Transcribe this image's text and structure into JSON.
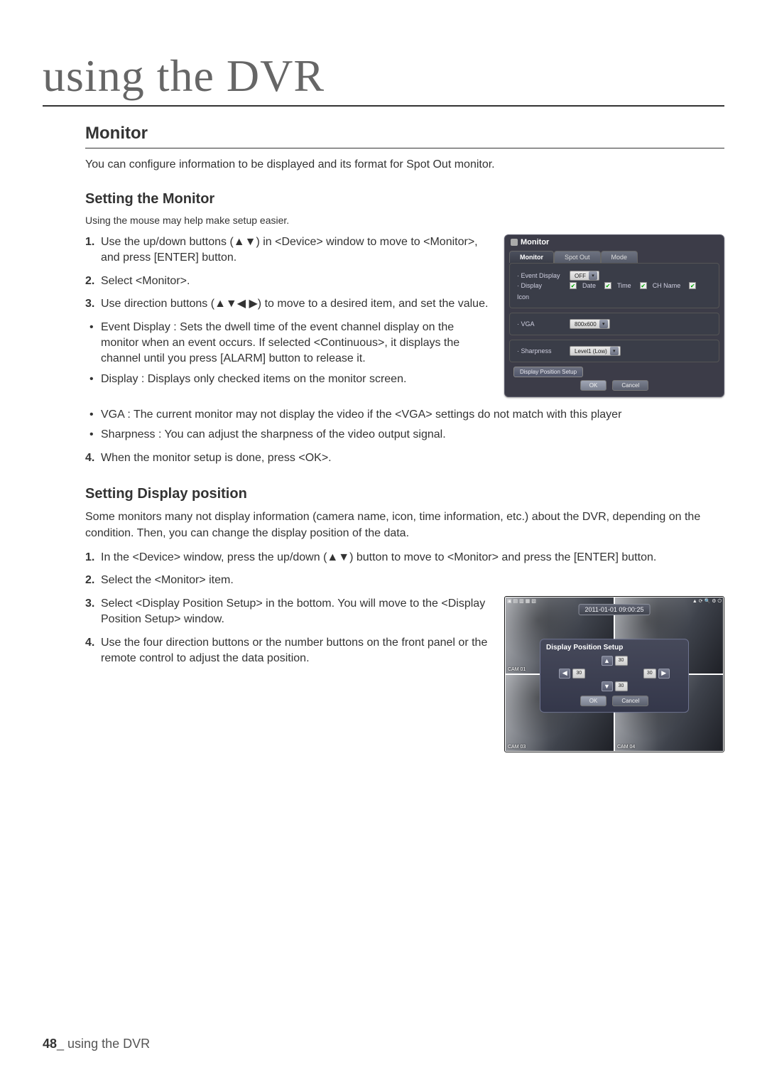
{
  "header": "using the DVR",
  "section": {
    "title": "Monitor",
    "intro": "You can configure information to be displayed and its format for Spot Out monitor."
  },
  "settingMonitor": {
    "heading": "Setting the Monitor",
    "note": "Using the mouse may help make setup easier.",
    "steps": [
      "Use the up/down buttons (▲▼) in <Device> window to move to <Monitor>, and press [ENTER] button.",
      "Select <Monitor>.",
      "Use direction buttons (▲▼◀ ▶) to move to a desired item, and set the value."
    ],
    "bullets_top": [
      "Event Display : Sets the dwell time of the event channel display on the monitor when an event occurs. If selected <Continuous>, it displays the channel until you press [ALARM] button to release it.",
      "Display : Displays only checked items on the monitor screen."
    ],
    "bullets_full": [
      "VGA : The current monitor may not display the video if the <VGA> settings do not match with this player",
      "Sharpness : You can adjust the sharpness of the video output signal."
    ],
    "step4": "When the monitor setup is done, press <OK>."
  },
  "settingDisplay": {
    "heading": "Setting Display position",
    "intro": "Some monitors many not display information (camera name, icon, time information, etc.) about the DVR, depending on the condition. Then, you can change the display position of the data.",
    "steps": [
      "In the <Device> window, press the up/down (▲▼) button to move to <Monitor> and press the [ENTER] button.",
      "Select the <Monitor> item.",
      "Select <Display Position Setup> in the bottom. You will move to the <Display Position Setup> window.",
      "Use the four direction buttons or the number buttons on the front panel or the remote control to adjust the data position."
    ]
  },
  "fig1": {
    "title": "Monitor",
    "tabs": {
      "monitor": "Monitor",
      "spotout": "Spot Out",
      "mode": "Mode"
    },
    "eventDisplay": {
      "label": "Event Display",
      "value": "OFF"
    },
    "display": {
      "label": "Display",
      "items": {
        "date": "Date",
        "time": "Time",
        "chname": "CH Name",
        "icon": "Icon"
      }
    },
    "vga": {
      "label": "VGA",
      "value": "800x600"
    },
    "sharpness": {
      "label": "Sharpness",
      "value": "Level1 (Low)"
    },
    "dpsBtn": "Display Position Setup",
    "ok": "OK",
    "cancel": "Cancel"
  },
  "fig2": {
    "datetime": "2011-01-01 09:00:25",
    "dialogTitle": "Display Position Setup",
    "spin": "30",
    "ok": "OK",
    "cancel": "Cancel",
    "cams": {
      "c1": "CAM 01",
      "c3": "CAM 03",
      "c4": "CAM 04"
    }
  },
  "footer": {
    "pageNumber": "48",
    "label": "using the DVR"
  }
}
